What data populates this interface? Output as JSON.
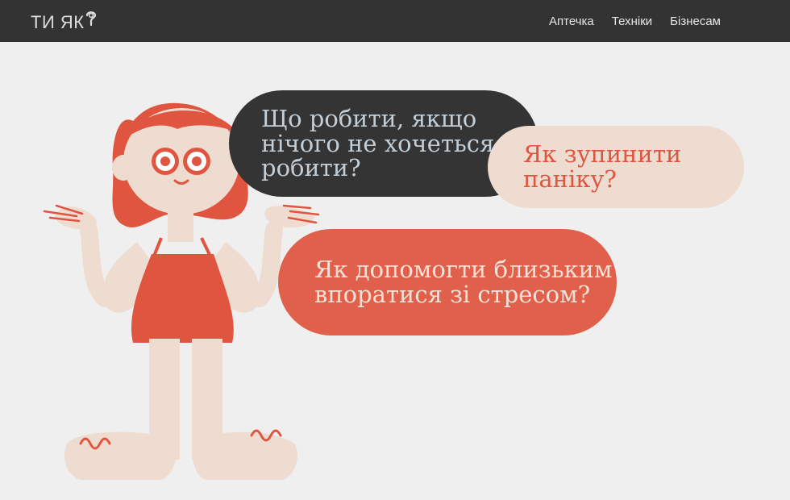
{
  "header": {
    "logo_text": "ТИ ЯК",
    "nav": [
      {
        "label": "Аптечка"
      },
      {
        "label": "Техніки"
      },
      {
        "label": "Бізнесам"
      }
    ]
  },
  "hero": {
    "bubbles": [
      {
        "text": "Що робити, якщо нічого не хочеться робити?"
      },
      {
        "text": "Як зупинити паніку?"
      },
      {
        "text": "Як допомогти близьким впоратися зі стресом?"
      }
    ]
  },
  "colors": {
    "topbar": "#333333",
    "background": "#efefef",
    "accent_red": "#e0553f",
    "skin": "#efdcd0",
    "dark_bubble": "#343434"
  }
}
